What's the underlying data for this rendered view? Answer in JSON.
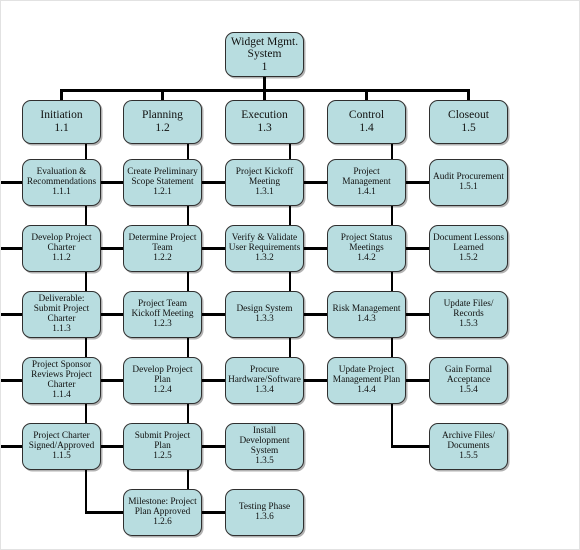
{
  "diagram": {
    "type": "work-breakdown-structure",
    "colors": {
      "node_fill": "#b8dde0",
      "node_stroke": "#2f2f2f",
      "connector": "#000000",
      "canvas": "#ffffff"
    },
    "root": {
      "title": "Widget Mgmt.\nSystem",
      "number": "1"
    },
    "phases": [
      {
        "title": "Initiation",
        "number": "1.1",
        "tasks": [
          {
            "title": "Evaluation &\nRecommendations",
            "number": "1.1.1"
          },
          {
            "title": "Develop Project\nCharter",
            "number": "1.1.2"
          },
          {
            "title": "Deliverable:\nSubmit Project\nCharter",
            "number": "1.1.3"
          },
          {
            "title": "Project Sponsor\nReviews Project\nCharter",
            "number": "1.1.4"
          },
          {
            "title": "Project Charter\nSigned/Approved",
            "number": "1.1.5"
          }
        ]
      },
      {
        "title": "Planning",
        "number": "1.2",
        "tasks": [
          {
            "title": "Create Preliminary\nScope Statement",
            "number": "1.2.1"
          },
          {
            "title": "Determine Project\nTeam",
            "number": "1.2.2"
          },
          {
            "title": "Project Team\nKickoff Meeting",
            "number": "1.2.3"
          },
          {
            "title": "Develop Project\nPlan",
            "number": "1.2.4"
          },
          {
            "title": "Submit Project\nPlan",
            "number": "1.2.5"
          },
          {
            "title": "Milestone: Project\nPlan Approved",
            "number": "1.2.6"
          }
        ]
      },
      {
        "title": "Execution",
        "number": "1.3",
        "tasks": [
          {
            "title": "Project Kickoff\nMeeting",
            "number": "1.3.1"
          },
          {
            "title": "Verify & Validate\nUser Requirements",
            "number": "1.3.2"
          },
          {
            "title": "Design System",
            "number": "1.3.3"
          },
          {
            "title": "Procure\nHardware/Software",
            "number": "1.3.4"
          },
          {
            "title": "Install\nDevelopment\nSystem",
            "number": "1.3.5"
          },
          {
            "title": "Testing Phase",
            "number": "1.3.6"
          }
        ]
      },
      {
        "title": "Control",
        "number": "1.4",
        "tasks": [
          {
            "title": "Project\nManagement",
            "number": "1.4.1"
          },
          {
            "title": "Project Status\nMeetings",
            "number": "1.4.2"
          },
          {
            "title": "Risk Management",
            "number": "1.4.3"
          },
          {
            "title": "Update Project\nManagement Plan",
            "number": "1.4.4"
          }
        ]
      },
      {
        "title": "Closeout",
        "number": "1.5",
        "tasks": [
          {
            "title": "Audit Procurement",
            "number": "1.5.1"
          },
          {
            "title": "Document Lessons\nLearned",
            "number": "1.5.2"
          },
          {
            "title": "Update Files/\nRecords",
            "number": "1.5.3"
          },
          {
            "title": "Gain Formal\nAcceptance",
            "number": "1.5.4"
          },
          {
            "title": "Archive Files/\nDocuments",
            "number": "1.5.5"
          }
        ]
      }
    ]
  }
}
